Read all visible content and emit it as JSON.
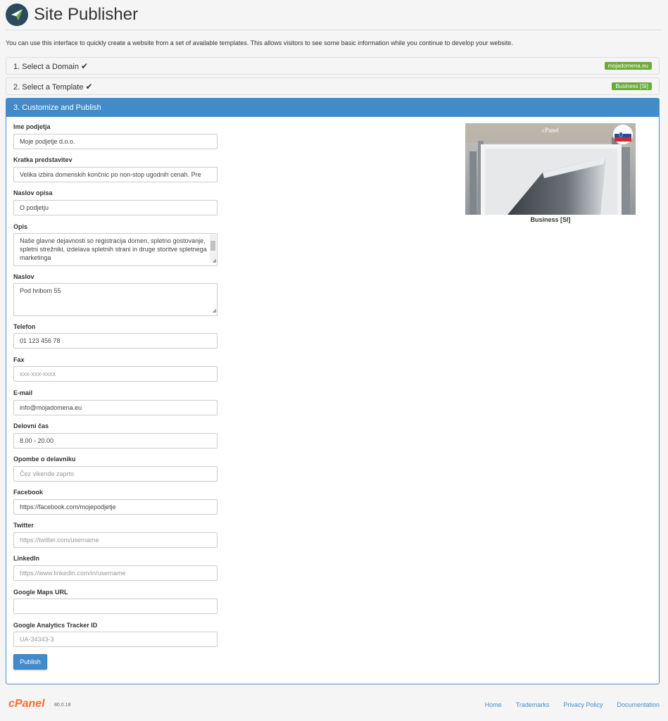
{
  "header": {
    "title": "Site Publisher"
  },
  "intro": "You can use this interface to quickly create a website from a set of available templates. This allows visitors to see some basic information while you continue to develop your website.",
  "steps": [
    {
      "label": "1. Select a Domain",
      "badge": "mojadomena.eu"
    },
    {
      "label": "2. Select a Template",
      "badge": "Business [SI]"
    },
    {
      "label": "3. Customize and Publish"
    }
  ],
  "form": {
    "company_name": {
      "label": "Ime podjetja",
      "value": "Moje podjetje d.o.o."
    },
    "short_intro": {
      "label": "Kratka predstavitev",
      "value": "Velika izbira domenskih končnic po non-stop ugodnih cenah. Pre"
    },
    "desc_title": {
      "label": "Naslov opisa",
      "value": "O podjetju"
    },
    "description": {
      "label": "Opis",
      "value": "Naše glavne dejavnosti so registracija domen, spletno gostovanje, spletni strežniki, izdelava spletnih strani in druge storitve spletnega marketinga"
    },
    "address": {
      "label": "Naslov",
      "value": "Pod hribom 55"
    },
    "phone": {
      "label": "Telefon",
      "value": "01 123 456 78"
    },
    "fax": {
      "label": "Fax",
      "placeholder": "xxx-xxx-xxxx"
    },
    "email": {
      "label": "E-mail",
      "value": "info@mojadomena.eu"
    },
    "hours": {
      "label": "Delovni čas",
      "value": "8.00 - 20.00"
    },
    "hours_note": {
      "label": "Opombe o delavniku",
      "placeholder": "Čez vikende zaprto"
    },
    "facebook": {
      "label": "Facebook",
      "value": "https://facebook.com/mojepodjetje"
    },
    "twitter": {
      "label": "Twitter",
      "placeholder": "https://twitter.com/username"
    },
    "linkedin": {
      "label": "LinkedIn",
      "placeholder": "https://www.linkedin.com/in/username"
    },
    "maps": {
      "label": "Google Maps URL",
      "value": ""
    },
    "analytics": {
      "label": "Google Analytics Tracker ID",
      "placeholder": "UA-34343-3"
    },
    "publish_label": "Publish"
  },
  "preview": {
    "caption": "Business [SI]",
    "brand": "cPanel"
  },
  "footer": {
    "logo": "cPanel",
    "version": "80.0.18",
    "links": [
      "Home",
      "Trademarks",
      "Privacy Policy",
      "Documentation"
    ]
  },
  "colors": {
    "primary": "#428bca",
    "badge": "#6aaa3a",
    "brand": "#ff6c2c"
  }
}
